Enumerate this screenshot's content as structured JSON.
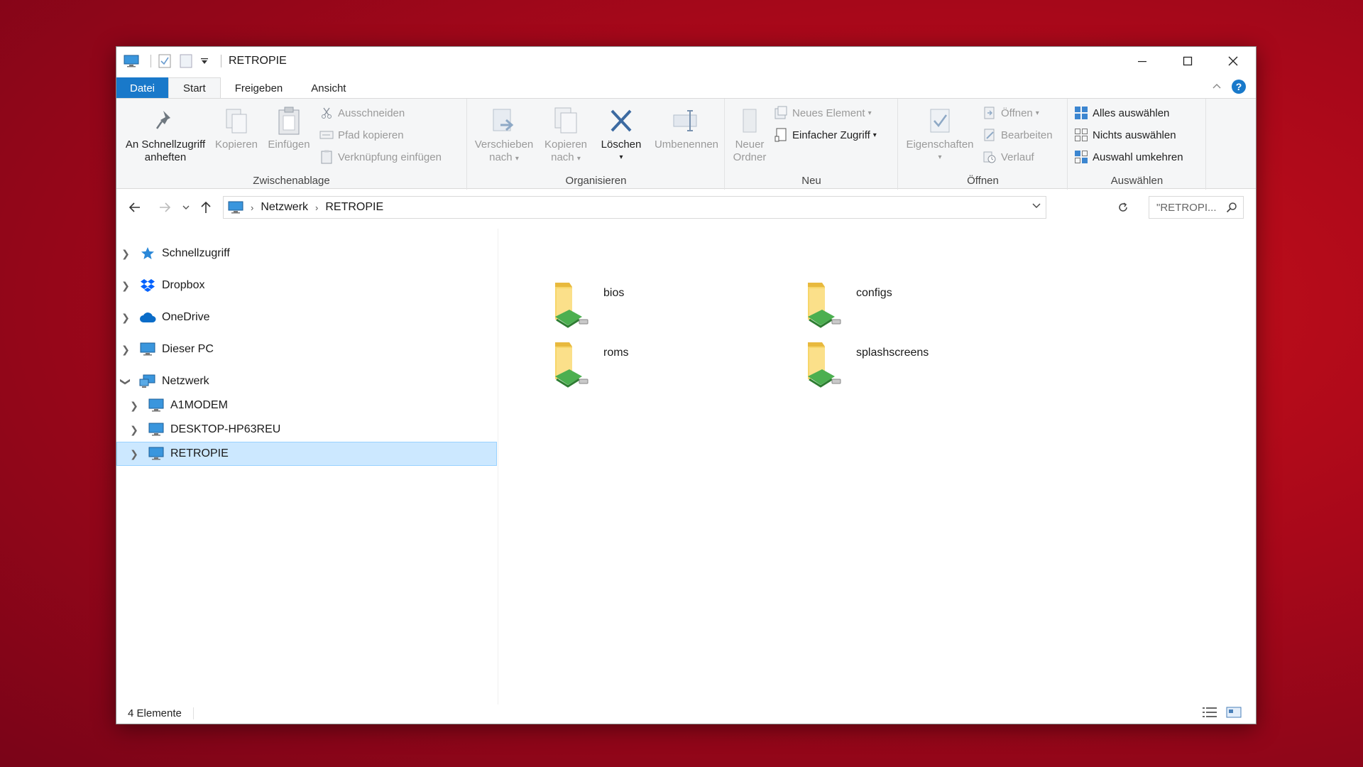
{
  "window": {
    "title": "RETROPIE"
  },
  "tabs": [
    {
      "label": "Datei"
    },
    {
      "label": "Start"
    },
    {
      "label": "Freigeben"
    },
    {
      "label": "Ansicht"
    }
  ],
  "ribbon": {
    "zwischenablage": {
      "label": "Zwischenablage",
      "pin_line1": "An Schnellzugriff",
      "pin_line2": "anheften",
      "copy": "Kopieren",
      "paste": "Einfügen",
      "cut": "Ausschneiden",
      "copy_path": "Pfad kopieren",
      "paste_shortcut": "Verknüpfung einfügen"
    },
    "organisieren": {
      "label": "Organisieren",
      "move_line1": "Verschieben",
      "move_line2": "nach",
      "copyto_line1": "Kopieren",
      "copyto_line2": "nach",
      "delete": "Löschen",
      "rename": "Umbenennen"
    },
    "neu": {
      "label": "Neu",
      "new_folder_line1": "Neuer",
      "new_folder_line2": "Ordner",
      "new_item": "Neues Element",
      "easy_access": "Einfacher Zugriff"
    },
    "oeffnen": {
      "label": "Öffnen",
      "properties": "Eigenschaften",
      "open": "Öffnen",
      "edit": "Bearbeiten",
      "history": "Verlauf"
    },
    "auswaehlen": {
      "label": "Auswählen",
      "select_all": "Alles auswählen",
      "select_none": "Nichts auswählen",
      "invert": "Auswahl umkehren"
    }
  },
  "address": {
    "crumbs": [
      "Netzwerk",
      "RETROPIE"
    ],
    "search_placeholder": "\"RETROPI..."
  },
  "nav": [
    {
      "label": "Schnellzugriff",
      "icon": "star-icon"
    },
    {
      "label": "Dropbox",
      "icon": "dropbox-icon"
    },
    {
      "label": "OneDrive",
      "icon": "cloud-icon"
    },
    {
      "label": "Dieser PC",
      "icon": "monitor-icon"
    },
    {
      "label": "Netzwerk",
      "icon": "network-icon"
    },
    {
      "label": "A1MODEM",
      "icon": "monitor-icon"
    },
    {
      "label": "DESKTOP-HP63REU",
      "icon": "monitor-icon"
    },
    {
      "label": "RETROPIE",
      "icon": "monitor-icon"
    }
  ],
  "folders": [
    {
      "name": "bios"
    },
    {
      "name": "configs"
    },
    {
      "name": "roms"
    },
    {
      "name": "splashscreens"
    }
  ],
  "status": {
    "count": "4 Elemente"
  },
  "colors": {
    "accent": "#1979ca",
    "selection": "#cce8ff",
    "background": "#b0081a"
  }
}
